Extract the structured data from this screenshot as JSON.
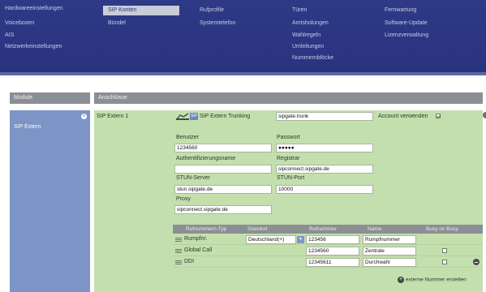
{
  "nav": {
    "col1": [
      "Hardwareeinstellungen",
      "Voiceboxen",
      "AIS",
      "Netzwerkeinstellungen"
    ],
    "col2": [
      "SIP Konten",
      "Bündel"
    ],
    "col3": [
      "Rufprofile",
      "Systemtelefon"
    ],
    "col4": [
      "Türen",
      "Amtsholungen",
      "Wahlregeln",
      "Umleitungen",
      "Nummernblöcke"
    ],
    "col5": [
      "Fernwartung",
      "Software-Update",
      "Lizenzverwaltung"
    ],
    "active": "SIP Konten"
  },
  "headers": {
    "modules": "Module",
    "connections": "Anschlüsse"
  },
  "module": {
    "label": "SIP Extern"
  },
  "account": {
    "name": "SIP Extern 1",
    "badge": "SIP",
    "type_label": "SIP Extern Trunking",
    "trunk_value": "sipgate.trunk",
    "use_account_label": "Account verwenden",
    "use_account_checked": true,
    "user_label": "Benutzer",
    "user_value": "1234560",
    "password_label": "Passwort",
    "password_value": "●●●●●",
    "authname_label": "Authentifizierungsname",
    "authname_value": "",
    "registrar_label": "Registrar",
    "registrar_value": "sipconnect.sipgate.de",
    "stun_server_label": "STUN-Server",
    "stun_server_value": "stun.sipgate.de",
    "stun_port_label": "STUN-Port",
    "stun_port_value": "10000",
    "proxy_label": "Proxy",
    "proxy_value": "sipconnect.sipgate.de"
  },
  "numbers": {
    "headers": [
      "Rufnummern-Typ",
      "Standort",
      "Rufnummer",
      "Name",
      "Busy on Busy"
    ],
    "rows": [
      {
        "type": "Rumpfnr.",
        "location": "Deutschland(+)",
        "number": "123456",
        "name": "Rumpfnummer"
      },
      {
        "type": "Global Call",
        "number": "1234560",
        "name": "Zentrale",
        "busy": false
      },
      {
        "type": "DDI",
        "number": "12345611",
        "name": "Durchwahl",
        "busy": false
      }
    ],
    "add_label": "externe Nummer erstellen"
  }
}
